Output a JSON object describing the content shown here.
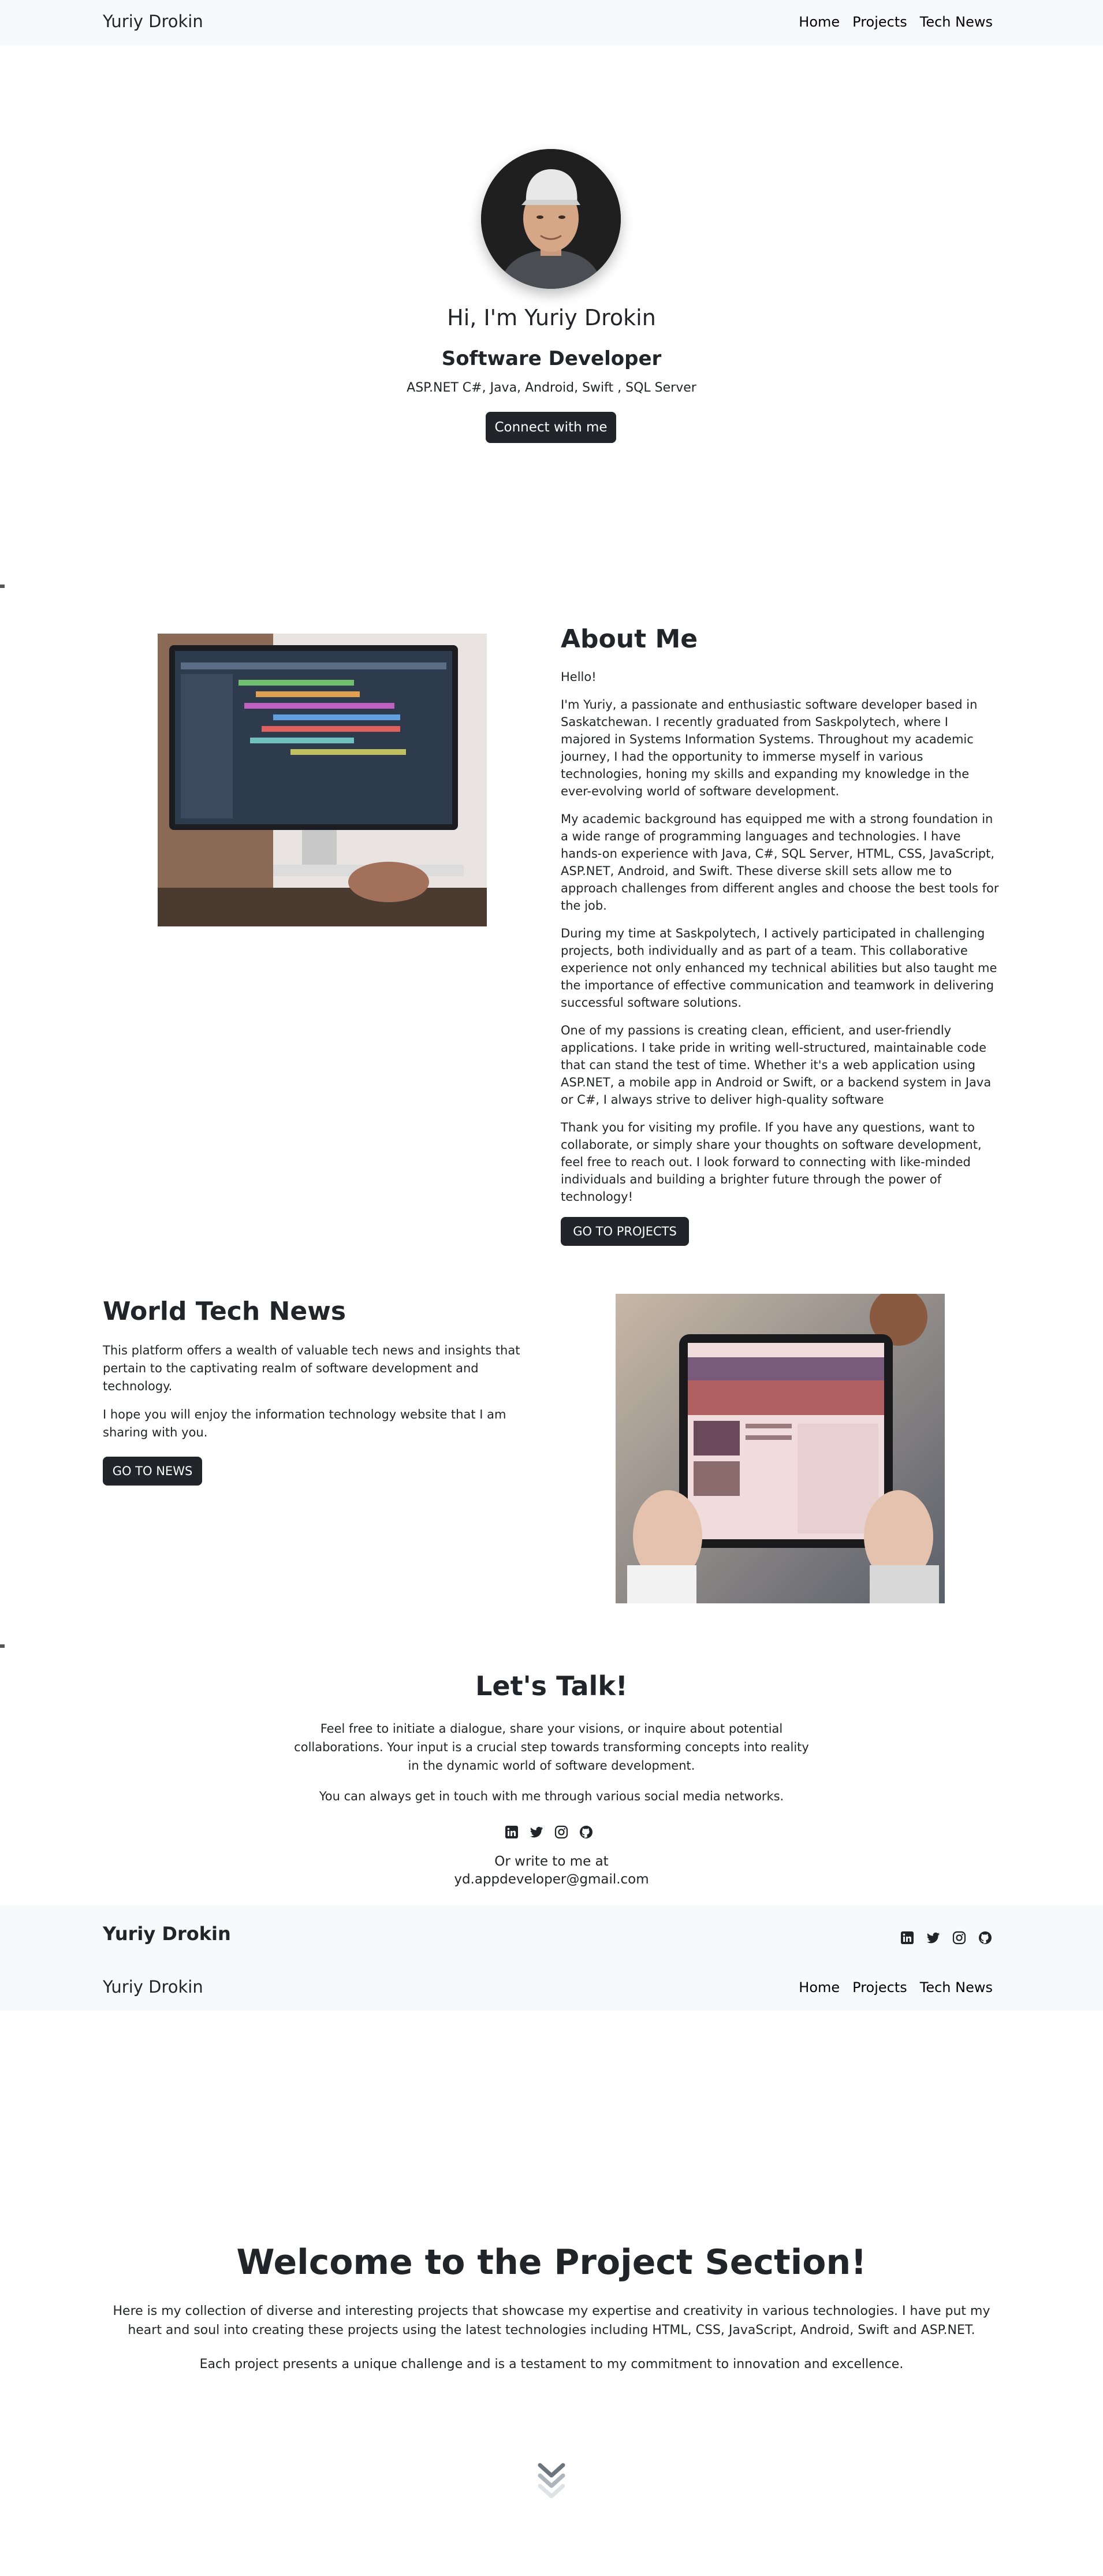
{
  "nav": {
    "brand": "Yuriy Drokin",
    "links": [
      "Home",
      "Projects",
      "Tech News"
    ]
  },
  "hero": {
    "greeting": "Hi, I'm Yuriy Drokin",
    "role": "Software Developer",
    "tech": "ASP.NET C#, Java, Android, Swift , SQL Server",
    "connect_button": "Connect with me"
  },
  "about": {
    "title": "About Me",
    "paragraphs": [
      "Hello!",
      "I'm Yuriy, a passionate and enthusiastic software developer based in Saskatchewan. I recently graduated from Saskpolytech, where I majored in Systems Information Systems. Throughout my academic journey, I had the opportunity to immerse myself in various technologies, honing my skills and expanding my knowledge in the ever-evolving world of software development.",
      "My academic background has equipped me with a strong foundation in a wide range of programming languages and technologies. I have hands-on experience with Java, C#, SQL Server, HTML, CSS, JavaScript, ASP.NET, Android, and Swift. These diverse skill sets allow me to approach challenges from different angles and choose the best tools for the job.",
      "During my time at Saskpolytech, I actively participated in challenging projects, both individually and as part of a team. This collaborative experience not only enhanced my technical abilities but also taught me the importance of effective communication and teamwork in delivering successful software solutions.",
      "One of my passions is creating clean, efficient, and user-friendly applications. I take pride in writing well-structured, maintainable code that can stand the test of time. Whether it's a web application using ASP.NET, a mobile app in Android or Swift, or a backend system in Java or C#, I always strive to deliver high-quality software",
      "Thank you for visiting my profile. If you have any questions, want to collaborate, or simply share your thoughts on software development, feel free to reach out. I look forward to connecting with like-minded individuals and building a brighter future through the power of technology!"
    ],
    "button": "GO TO PROJECTS"
  },
  "news": {
    "title": "World Tech News",
    "paragraphs": [
      "This platform offers a wealth of valuable tech news and insights that pertain to the captivating realm of software development and technology.",
      "I hope you will enjoy the information technology website that I am sharing with you."
    ],
    "button": "GO TO NEWS"
  },
  "talk": {
    "title": "Let's Talk!",
    "text": "Feel free to initiate a dialogue, share your visions, or inquire about potential collaborations. Your input is a crucial step towards transforming concepts into reality in the dynamic world of software development.",
    "sub": "You can always get in touch with me through various social media networks.",
    "social_icons": [
      "linkedin-icon",
      "twitter-icon",
      "instagram-icon",
      "github-icon"
    ],
    "write": "Or write to me at",
    "email": "yd.appdeveloper@gmail.com"
  },
  "footer": {
    "brand": "Yuriy Drokin"
  },
  "projects": {
    "title": "Welcome to the Project Section!",
    "text": "Here is my collection of diverse and interesting projects that showcase my expertise and creativity in various technologies. I have put my heart and soul into creating these projects using the latest technologies including HTML, CSS, JavaScript, Android, Swift and ASP.NET.",
    "text2": "Each project presents a unique challenge and is a testament to my commitment to innovation and excellence."
  },
  "colors": {
    "accent": "#212529",
    "navbar_bg": "#f8f9fa"
  }
}
